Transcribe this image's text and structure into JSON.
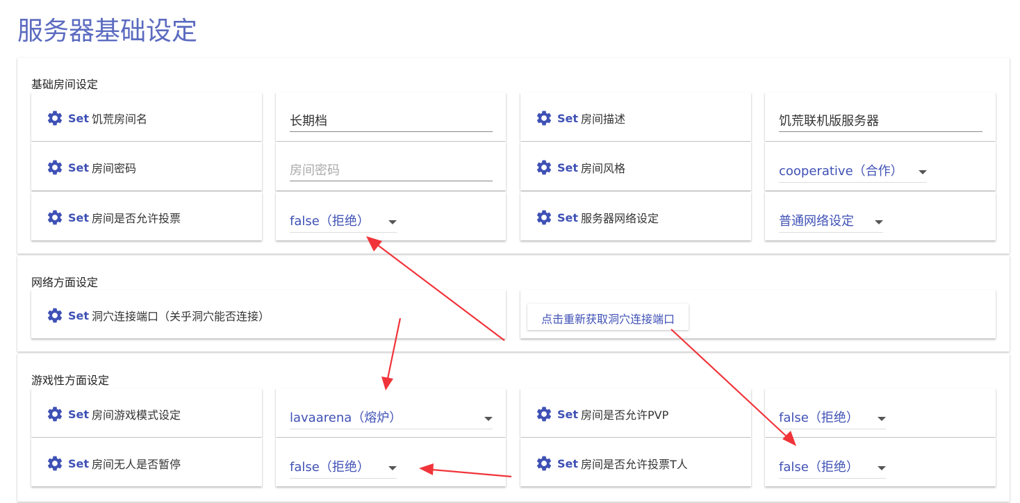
{
  "page": {
    "title": "服务器基础设定"
  },
  "common": {
    "set_word": "Set"
  },
  "sections": {
    "basic": {
      "label": "基础房间设定"
    },
    "network": {
      "label": "网络方面设定"
    },
    "gameplay": {
      "label": "游戏性方面设定"
    }
  },
  "basic": {
    "room_name": {
      "label": "饥荒房间名",
      "value": "长期档"
    },
    "room_desc": {
      "label": "房间描述",
      "value": "饥荒联机版服务器"
    },
    "room_password": {
      "label": "房间密码",
      "placeholder": "房间密码"
    },
    "room_style": {
      "label": "房间风格",
      "value": "cooperative（合作）"
    },
    "allow_vote": {
      "label": "房间是否允许投票",
      "value": "false（拒绝）"
    },
    "network_setting": {
      "label": "服务器网络设定",
      "value": "普通网络设定"
    }
  },
  "network": {
    "cave_port": {
      "label": "洞穴连接端口（关乎洞穴能否连接）",
      "button": "点击重新获取洞穴连接端口"
    }
  },
  "gameplay": {
    "game_mode": {
      "label": "房间游戏模式设定",
      "value": "lavaarena（熔炉）"
    },
    "allow_pvp": {
      "label": "房间是否允许PVP",
      "value": "false（拒绝）"
    },
    "pause_empty": {
      "label": "房间无人是否暂停",
      "value": "false（拒绝）"
    },
    "vote_kick": {
      "label": "房间是否允许投票T人",
      "value": "false（拒绝）"
    }
  },
  "icons": {
    "settings": "gear-icon",
    "dropdown": "caret-down-icon"
  },
  "colors": {
    "accent": "#3f51b5",
    "title": "#5c6bc0",
    "annotation_arrow": "#f0343a"
  }
}
